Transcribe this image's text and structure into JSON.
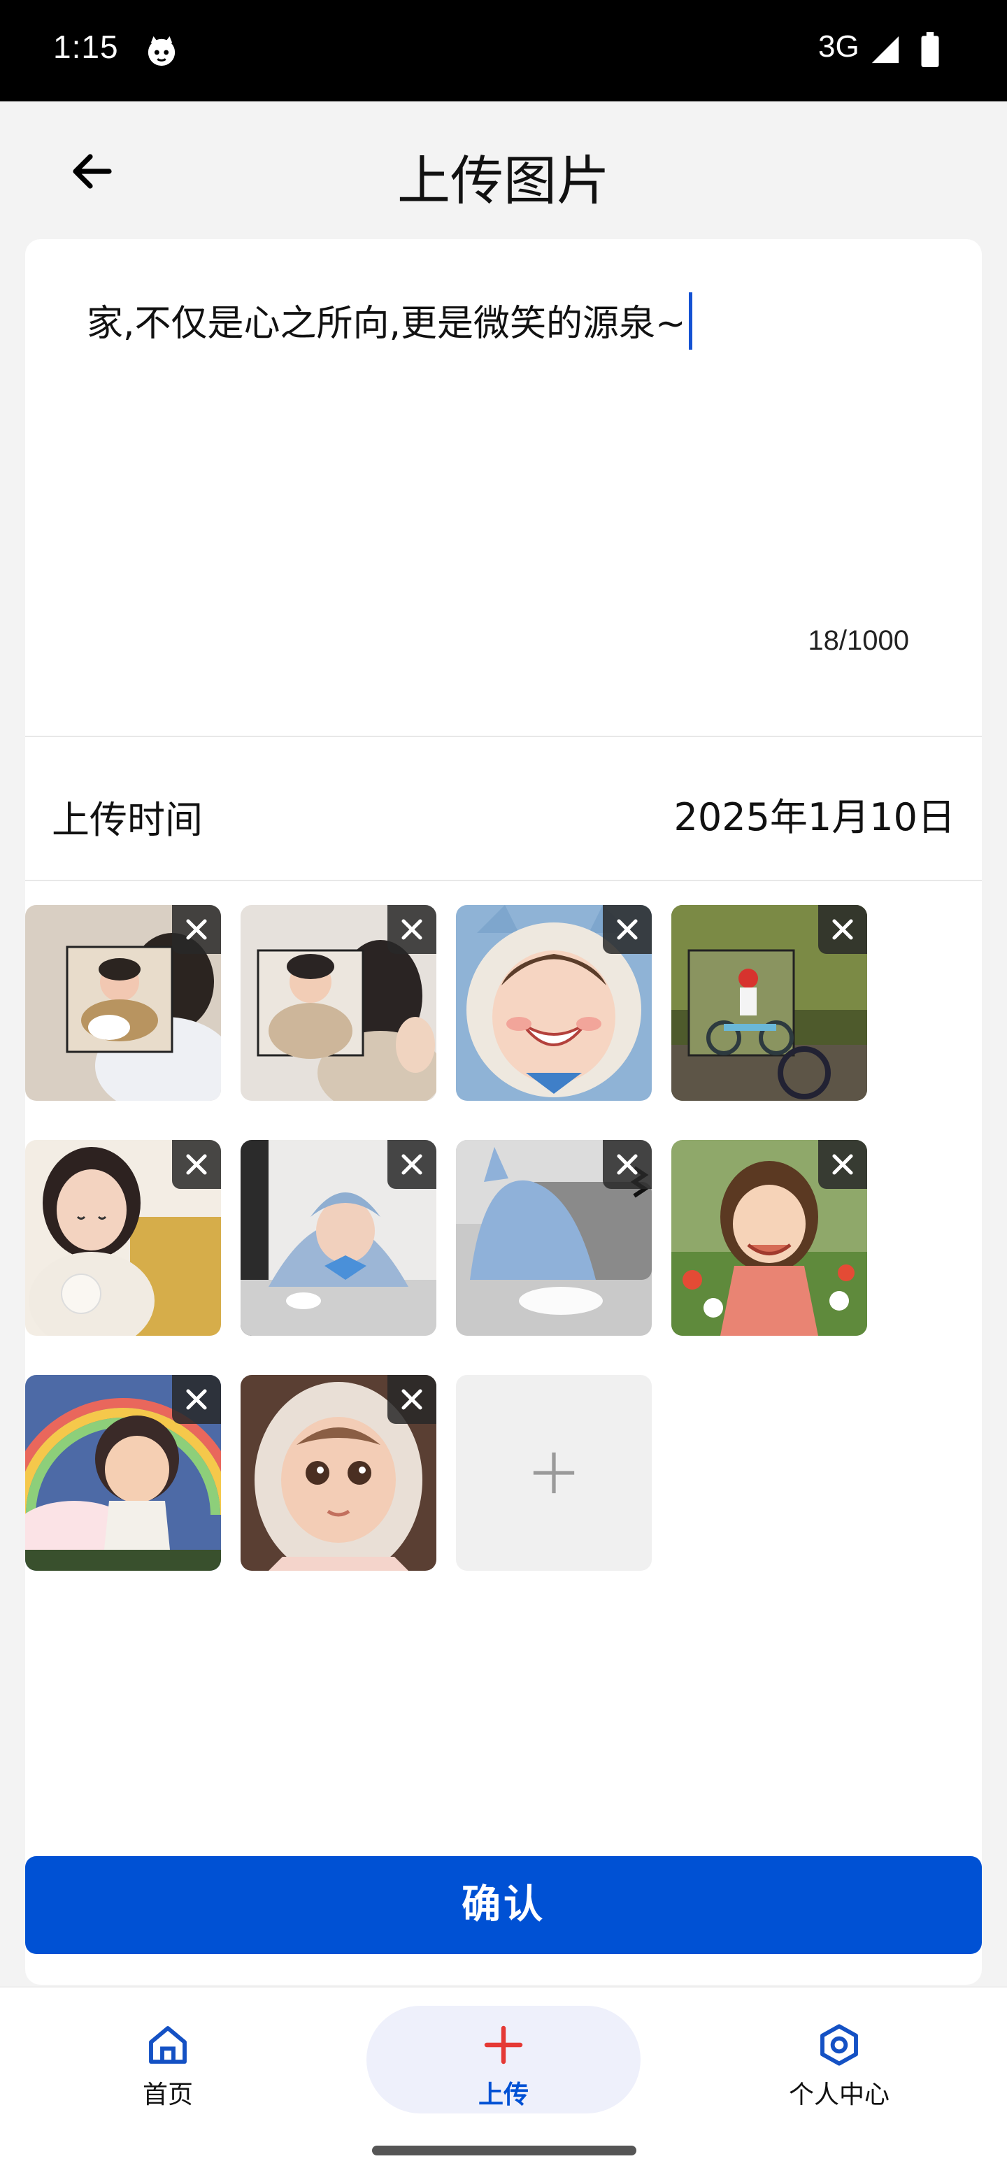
{
  "status_bar": {
    "time": "1:15",
    "network": "3G"
  },
  "header": {
    "title": "上传图片"
  },
  "editor": {
    "text": "家,不仅是心之所向,更是微笑的源泉~",
    "counter": "18/1000"
  },
  "date_row": {
    "label": "上传时间",
    "value": "2025年1月10日"
  },
  "images": [
    {
      "name": "photo-1"
    },
    {
      "name": "photo-2"
    },
    {
      "name": "photo-3"
    },
    {
      "name": "photo-4"
    },
    {
      "name": "photo-5"
    },
    {
      "name": "photo-6"
    },
    {
      "name": "photo-7"
    },
    {
      "name": "photo-8"
    },
    {
      "name": "photo-9"
    },
    {
      "name": "photo-10"
    }
  ],
  "confirm_label": "确认",
  "nav": {
    "home": {
      "label": "首页",
      "icon": "home-icon"
    },
    "upload": {
      "label": "上传",
      "icon": "plus-icon",
      "active": true
    },
    "profile": {
      "label": "个人中心",
      "icon": "hexagon-icon"
    }
  },
  "colors": {
    "accent": "#0051d4",
    "upload_icon": "#e53935",
    "active_pill": "#eef0fb"
  }
}
